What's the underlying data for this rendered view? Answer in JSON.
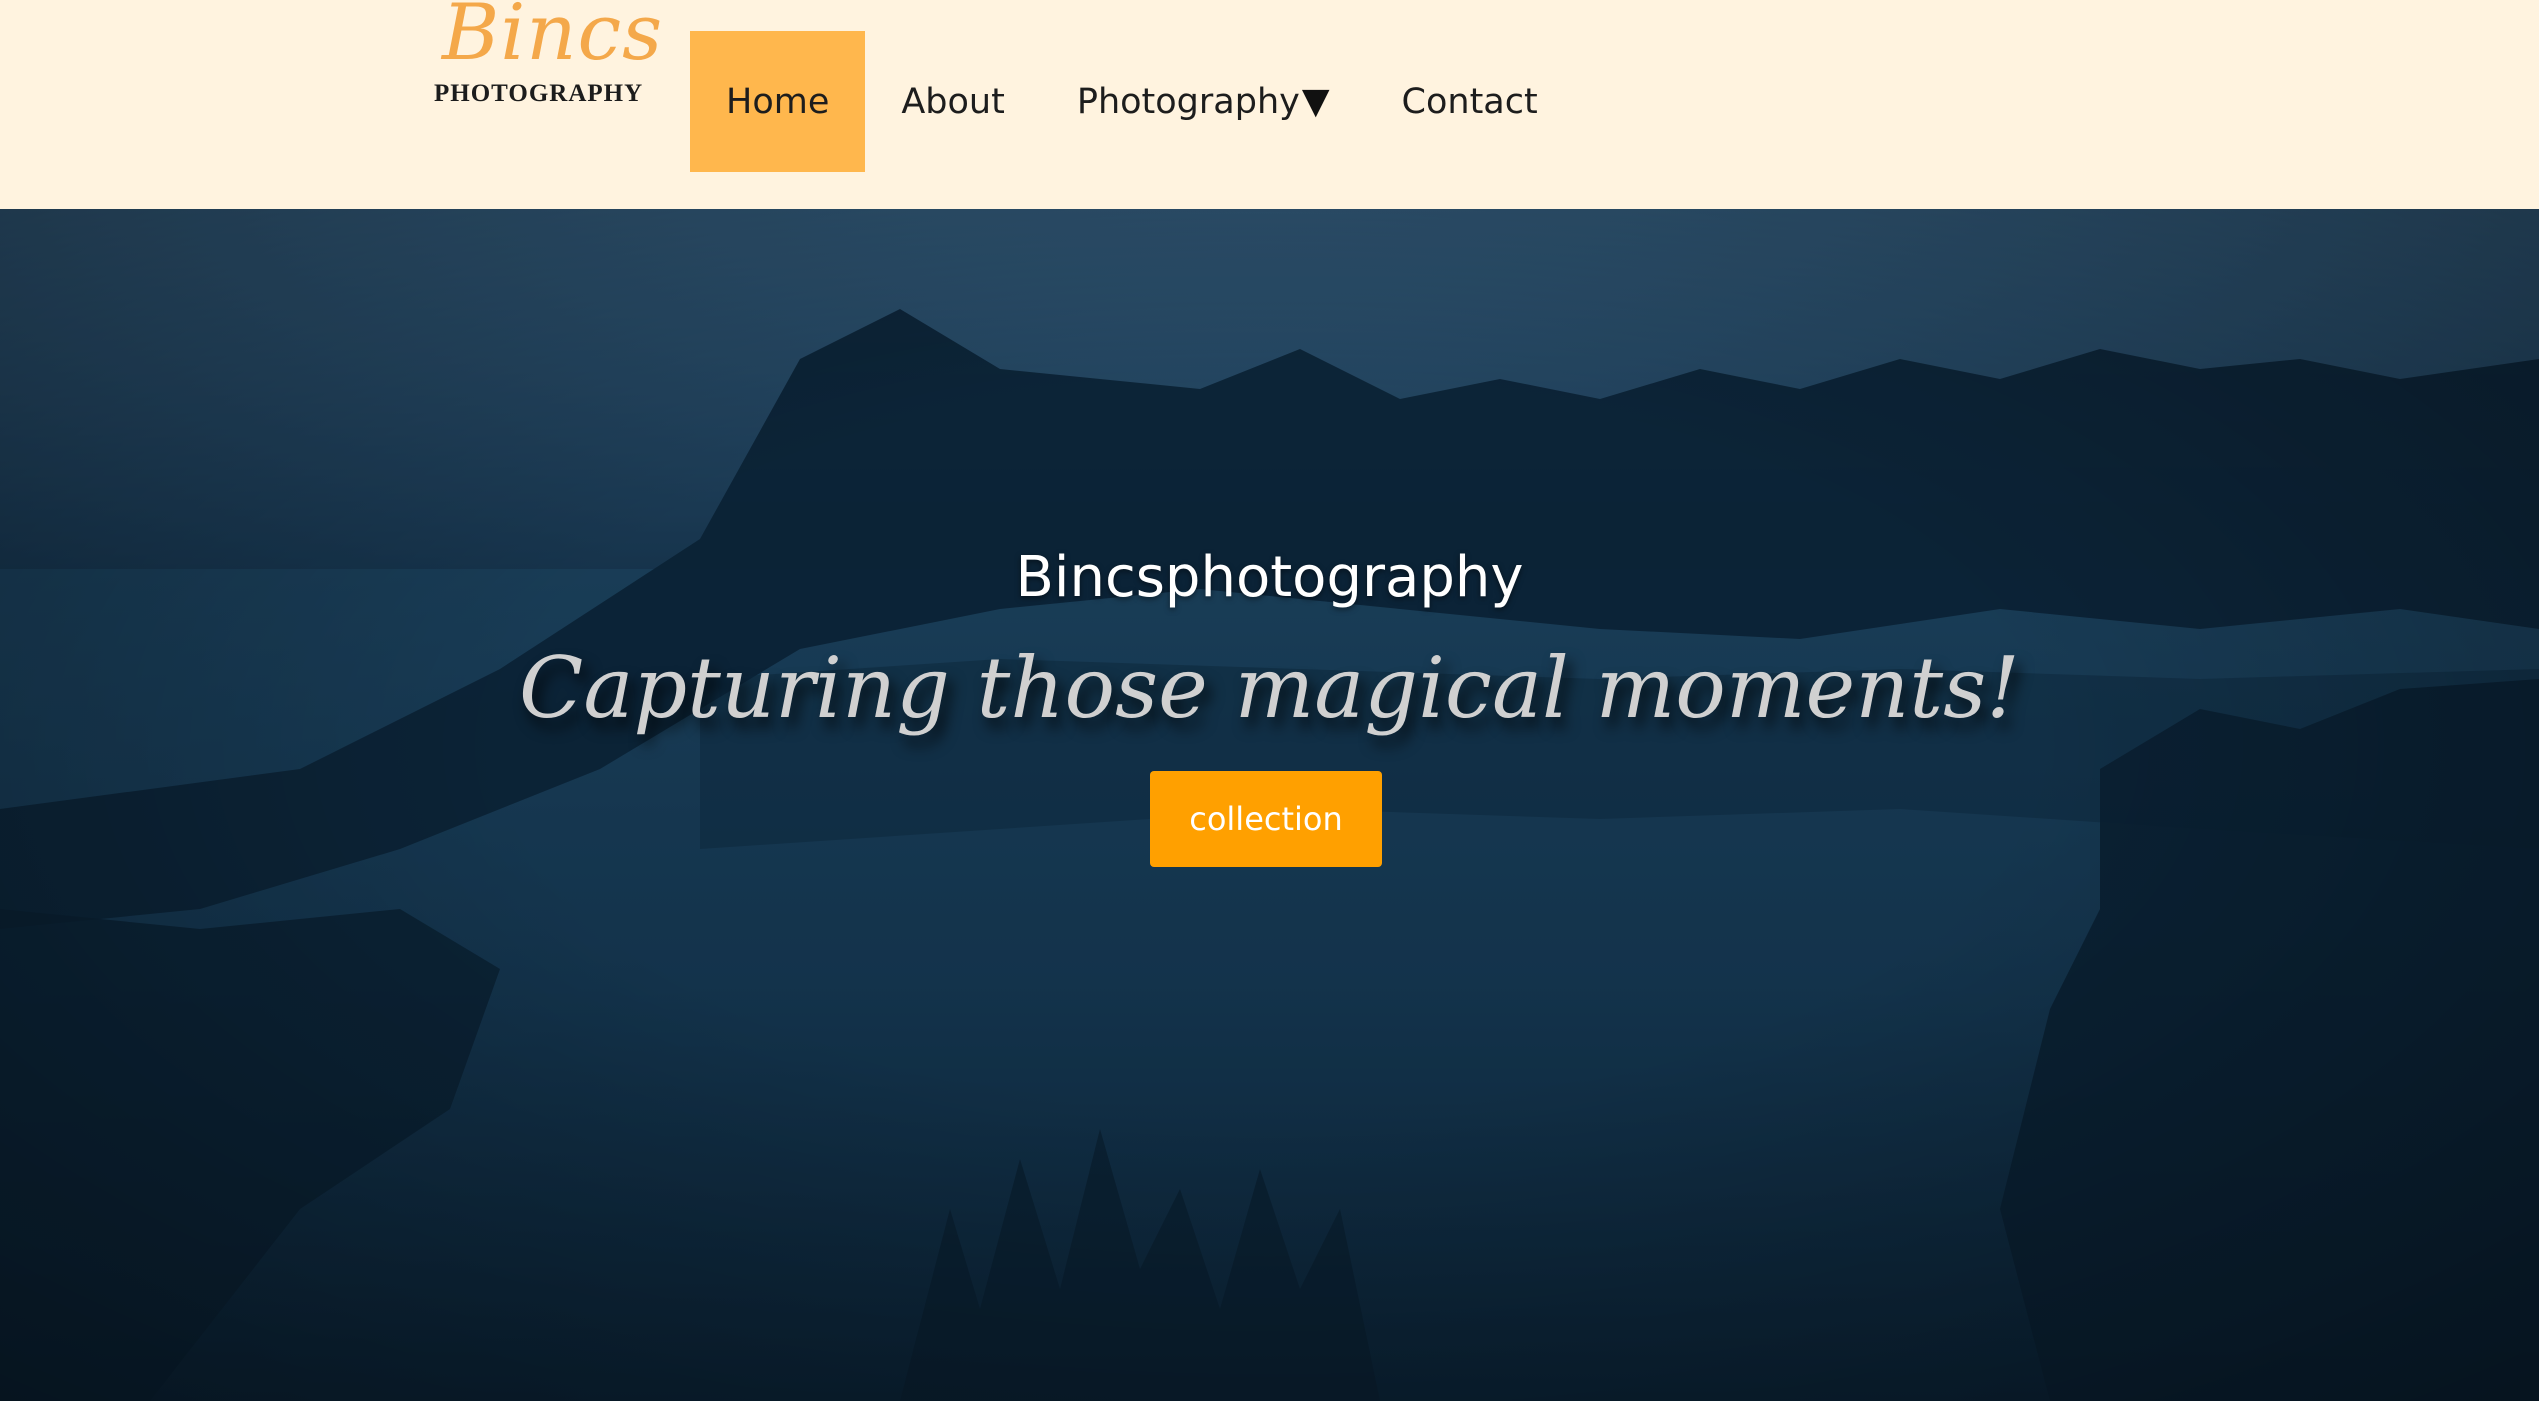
{
  "header": {
    "logo": {
      "script": "Bincs",
      "subtitle": "PHOTOGRAPHY"
    },
    "nav": [
      {
        "label": "Home",
        "active": true
      },
      {
        "label": "About",
        "active": false
      },
      {
        "label": "Photography",
        "active": false,
        "has_dropdown": true
      },
      {
        "label": "Contact",
        "active": false
      }
    ],
    "dropdown_caret": "▼"
  },
  "hero": {
    "title": "Bincsphotography",
    "tagline": "Capturing those magical moments!",
    "button_label": "collection"
  },
  "colors": {
    "header_bg": "#fff3df",
    "active_nav_bg": "#ffb74d",
    "button_bg": "#ffa000",
    "logo_script": "#f4a84a",
    "hero_overlay": "#0d2a40"
  }
}
